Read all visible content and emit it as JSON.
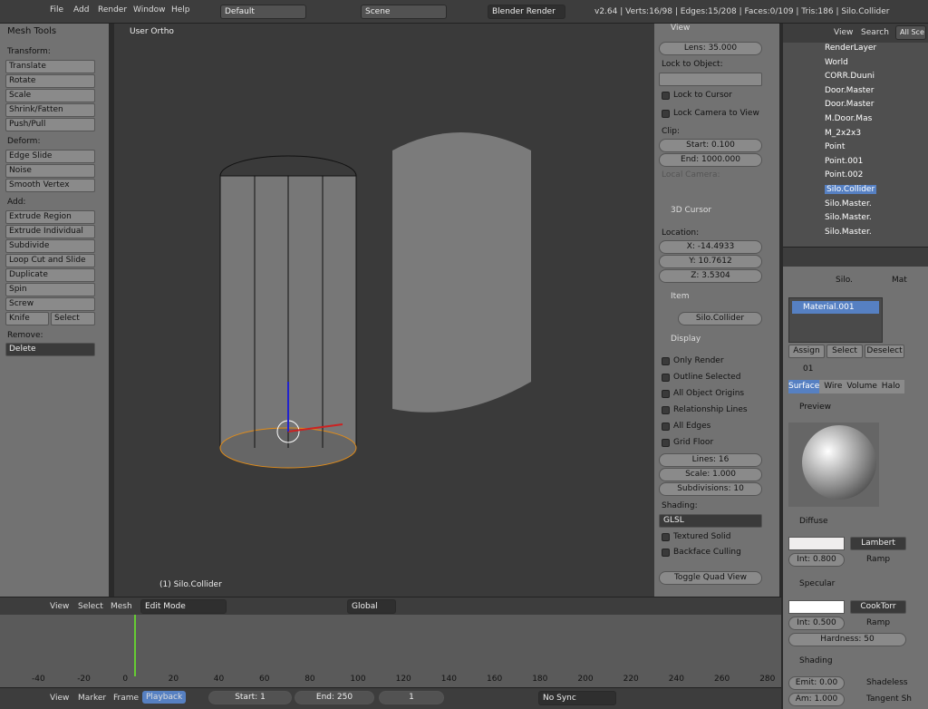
{
  "top": {
    "menus": [
      "File",
      "Add",
      "Render",
      "Window",
      "Help"
    ],
    "layout": "Default",
    "scene": "Scene",
    "engine": "Blender Render",
    "stats": "v2.64 | Verts:16/98 | Edges:15/208 | Faces:0/109 | Tris:186 | Silo.Collider"
  },
  "tools": {
    "title": "Mesh Tools",
    "transform": "Transform:",
    "t": [
      "Translate",
      "Rotate",
      "Scale",
      "Shrink/Fatten",
      "Push/Pull"
    ],
    "deform": "Deform:",
    "d": [
      "Edge Slide",
      "Noise",
      "Smooth Vertex"
    ],
    "add": "Add:",
    "a": [
      "Extrude Region",
      "Extrude Individual",
      "Subdivide",
      "Loop Cut and Slide",
      "Duplicate",
      "Spin",
      "Screw",
      "Knife",
      "Select"
    ],
    "remove": "Remove:",
    "del": "Delete"
  },
  "view": {
    "label": "User Ortho",
    "obj": "(1) Silo.Collider"
  },
  "rp": {
    "view": "View",
    "lens": "Lens: 35.000",
    "lock": "Lock to Object:",
    "lockcur": "Lock to Cursor",
    "lockcam": "Lock Camera to View",
    "clip": "Clip:",
    "start": "Start: 0.100",
    "end": "End: 1000.000",
    "localcam": "Local Camera:",
    "cursor": "3D Cursor",
    "loc": "Location:",
    "x": "X: -14.4933",
    "y": "Y: 10.7612",
    "z": "Z: 3.5304",
    "item": "Item",
    "itemname": "Silo.Collider",
    "display": "Display",
    "opts": [
      "Only Render",
      "Outline Selected",
      "All Object Origins",
      "Relationship Lines",
      "All Edges",
      "Grid Floor"
    ],
    "lines": "Lines: 16",
    "scale": "Scale: 1.000",
    "subd": "Subdivisions: 10",
    "shading": "Shading:",
    "glsl": "GLSL",
    "tex": "Textured Solid",
    "back": "Backface Culling",
    "quad": "Toggle Quad View"
  },
  "outliner": {
    "view": "View",
    "search": "Search",
    "all": "All Sce",
    "items": [
      "RenderLayer",
      "World",
      "CORR.Duuni",
      "Door.Master",
      "Door.Master",
      "M.Door.Mas",
      "M_2x2x3",
      "Point",
      "Point.001",
      "Point.002",
      "Silo.Collider",
      "Silo.Master.",
      "Silo.Master.",
      "Silo.Master."
    ]
  },
  "props": {
    "crumb1": "Silo.",
    "crumb2": "Mat",
    "mat": "Material.001",
    "assign": "Assign",
    "select": "Select",
    "deselect": "Deselect",
    "slot": "01",
    "tabs": [
      "Surface",
      "Wire",
      "Volume",
      "Halo"
    ],
    "preview": "Preview",
    "diffuse": "Diffuse",
    "lambert": "Lambert",
    "dint": "Int: 0.800",
    "ramp": "Ramp",
    "specular": "Specular",
    "cook": "CookTorr",
    "sint": "Int: 0.500",
    "hard": "Hardness: 50",
    "shading": "Shading",
    "emit": "Emit: 0.00",
    "shadeless": "Shadeless",
    "amb": "Am: 1.000",
    "tangent": "Tangent Sh"
  },
  "vheader": {
    "view": "View",
    "select": "Select",
    "mesh": "Mesh",
    "mode": "Edit Mode",
    "global": "Global"
  },
  "timeline": {
    "ticks": [
      "-40",
      "-20",
      "0",
      "20",
      "40",
      "60",
      "80",
      "100",
      "120",
      "140",
      "160",
      "180",
      "200",
      "220",
      "240",
      "260",
      "280"
    ],
    "view": "View",
    "marker": "Marker",
    "frame": "Frame",
    "playback": "Playback",
    "start": "Start: 1",
    "end": "End: 250",
    "cur": "1",
    "sync": "No Sync"
  }
}
